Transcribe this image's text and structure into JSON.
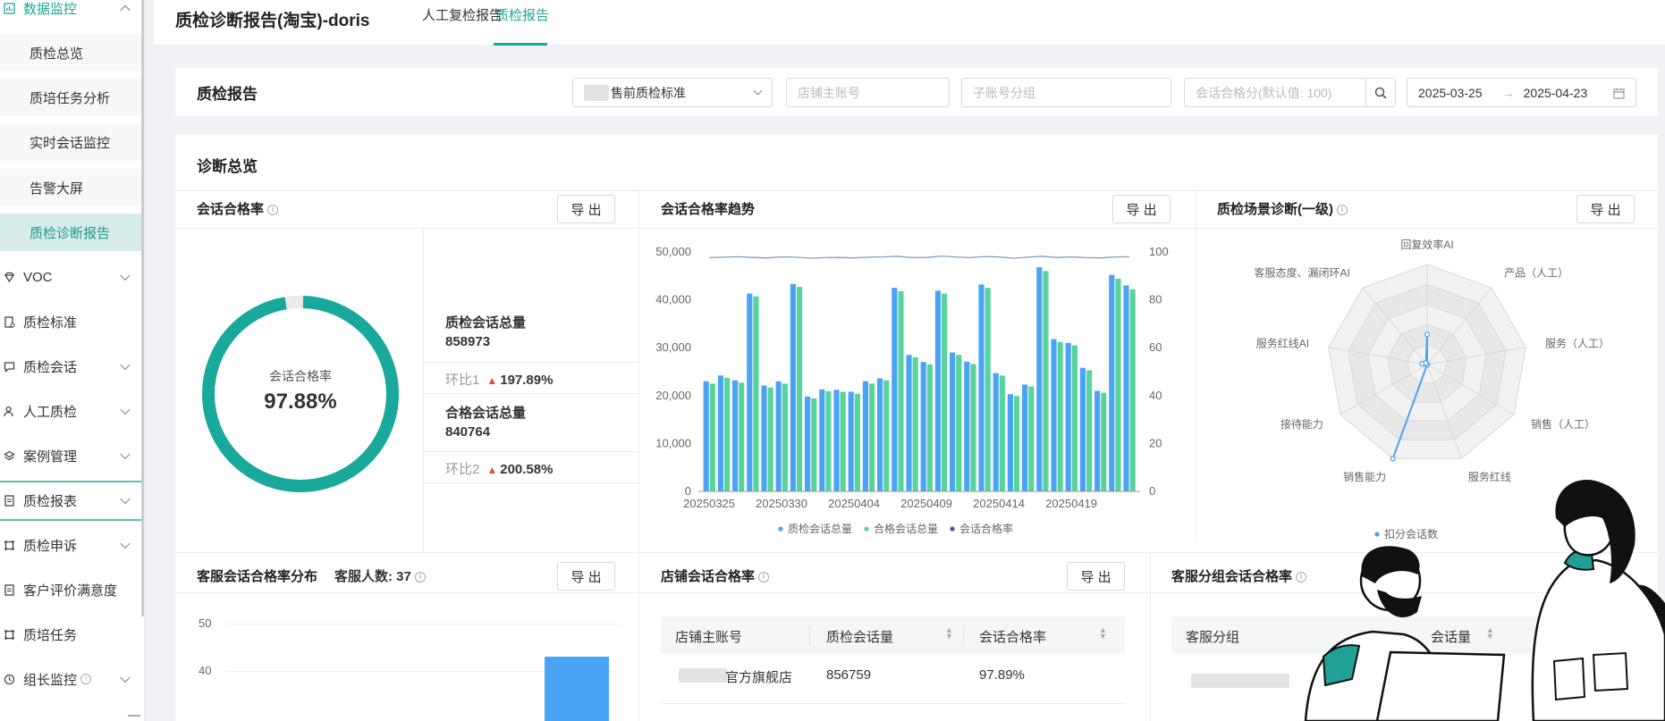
{
  "sidebar": {
    "items": [
      {
        "label": "数据监控",
        "icon": "chart-icon",
        "expanded": true
      },
      {
        "label": "质检总览",
        "sub": true
      },
      {
        "label": "质培任务分析",
        "sub": true
      },
      {
        "label": "实时会话监控",
        "sub": true
      },
      {
        "label": "告警大屏",
        "sub": true
      },
      {
        "label": "质检诊断报告",
        "sub": true,
        "active": true
      },
      {
        "label": "VOC",
        "icon": "diamond-icon"
      },
      {
        "label": "质检标准",
        "icon": "doc-icon"
      },
      {
        "label": "质检会话",
        "icon": "chat-icon"
      },
      {
        "label": "人工质检",
        "icon": "user-icon"
      },
      {
        "label": "案例管理",
        "icon": "layers-icon"
      },
      {
        "label": "质检报表",
        "icon": "report-icon"
      },
      {
        "label": "质检申诉",
        "icon": "appeal-icon"
      },
      {
        "label": "客户评价满意度",
        "icon": "rating-icon"
      },
      {
        "label": "质培任务",
        "icon": "task-icon"
      },
      {
        "label": "组长监控",
        "icon": "clock-icon"
      }
    ]
  },
  "header": {
    "title": "质检诊断报告(淘宝)-doris",
    "tabs": [
      "质检报告",
      "人工复检报告"
    ]
  },
  "filters": {
    "title": "质检报告",
    "standard": "售前质检标准",
    "shop_placeholder": "店铺主账号",
    "group_placeholder": "子账号分组",
    "score_placeholder": "会话合格分(默认值: 100)",
    "date_start": "2025-03-25",
    "date_arrow": "→",
    "date_end": "2025-04-23"
  },
  "overview": {
    "title": "诊断总览",
    "export_label": "导 出",
    "pass_rate_card": {
      "title": "会话合格率",
      "donut_label": "会话合格率",
      "donut_value": "97.88%",
      "donut_fraction": 0.9788,
      "total_label": "质检会话总量",
      "total_value": "858973",
      "ratio1_label": "环比1",
      "ratio1_value": "197.89%",
      "pass_label": "合格会话总量",
      "pass_value": "840764",
      "ratio2_label": "环比2",
      "ratio2_value": "200.58%"
    },
    "trend_card": {
      "title": "会话合格率趋势"
    },
    "radar_card": {
      "title": "质检场景诊断(一级)",
      "axes": [
        "回复效率AI",
        "产品（人工）",
        "服务（人工）",
        "销售（人工）",
        "服务红线",
        "销售能力",
        "接待能力",
        "服务红线AI",
        "客服态度、漏闭环AI"
      ],
      "legend": "扣分会话数"
    },
    "agent_dist_card": {
      "title": "客服会话合格率分布",
      "count_label": "客服人数: 37",
      "y_ticks": [
        "50",
        "40"
      ],
      "bar_value": 43
    },
    "shop_card": {
      "title": "店铺会话合格率",
      "columns": [
        "店铺主账号",
        "质检会话量",
        "会话合格率"
      ],
      "rows": [
        {
          "shop": "旗舰店",
          "shop_suffix": "官方旗舰店",
          "count": "856759",
          "rate": "97.89%"
        }
      ]
    },
    "group_card": {
      "title": "客服分组会话合格率",
      "columns": [
        "客服分组",
        "会话量"
      ]
    }
  },
  "chart_data": {
    "type": "bar",
    "x": [
      "20250325",
      "20250326",
      "20250327",
      "20250328",
      "20250329",
      "20250330",
      "20250331",
      "20250401",
      "20250402",
      "20250403",
      "20250404",
      "20250405",
      "20250406",
      "20250407",
      "20250408",
      "20250409",
      "20250410",
      "20250411",
      "20250412",
      "20250413",
      "20250414",
      "20250415",
      "20250416",
      "20250417",
      "20250418",
      "20250419",
      "20250420",
      "20250421",
      "20250422",
      "20250423"
    ],
    "x_tick_labels": [
      "20250325",
      "20250330",
      "20250404",
      "20250409",
      "20250414",
      "20250419"
    ],
    "series": [
      {
        "name": "质检会话总量",
        "axis": "left",
        "color": "#4aa3f5",
        "values": [
          23000,
          24200,
          23200,
          41300,
          22100,
          23000,
          43300,
          19800,
          21300,
          21200,
          20800,
          23000,
          23600,
          42500,
          28500,
          27000,
          41900,
          29000,
          27100,
          43200,
          24700,
          20300,
          22300,
          46800,
          31800,
          31000,
          25800,
          21000,
          45200,
          43000
        ]
      },
      {
        "name": "合格会话总量",
        "axis": "left",
        "color": "#57d49b",
        "values": [
          22500,
          23700,
          22700,
          40700,
          21700,
          22500,
          42700,
          19400,
          20900,
          20800,
          20400,
          22500,
          23200,
          41800,
          28000,
          26500,
          41300,
          28500,
          26600,
          42500,
          24200,
          19900,
          21900,
          46000,
          31200,
          30500,
          25300,
          20600,
          44400,
          42200
        ]
      },
      {
        "name": "会话合格率",
        "axis": "right",
        "color": "#7f9fbf",
        "type": "line",
        "values": [
          97.6,
          97.8,
          98.0,
          97.7,
          97.5,
          97.9,
          97.8,
          97.4,
          97.6,
          97.7,
          97.5,
          97.8,
          97.9,
          98.2,
          97.6,
          97.7,
          98.3,
          97.9,
          97.6,
          98.1,
          97.9,
          97.4,
          97.8,
          98.2,
          97.7,
          97.9,
          97.6,
          97.5,
          97.9,
          98.0
        ]
      }
    ],
    "y_left": {
      "ticks": [
        "0",
        "10,000",
        "20,000",
        "30,000",
        "40,000",
        "50,000"
      ],
      "ylim": [
        0,
        50000
      ]
    },
    "y_right": {
      "ticks": [
        "0",
        "20",
        "40",
        "60",
        "80",
        "100"
      ],
      "ylim": [
        0,
        100
      ]
    },
    "legend": [
      "质检会话总量",
      "合格会话总量",
      "会话合格率"
    ]
  },
  "radar_data": {
    "type": "radar",
    "axes": [
      "回复效率AI",
      "产品（人工）",
      "服务（人工）",
      "销售（人工）",
      "服务红线",
      "销售能力",
      "接待能力",
      "服务红线AI",
      "客服态度、漏闭环AI"
    ],
    "series": [
      {
        "name": "扣分会话数",
        "values": [
          0.3,
          0.0,
          0.0,
          0.0,
          0.0,
          1.0,
          0.0,
          0.05,
          0.02
        ]
      }
    ],
    "rings": 5
  }
}
